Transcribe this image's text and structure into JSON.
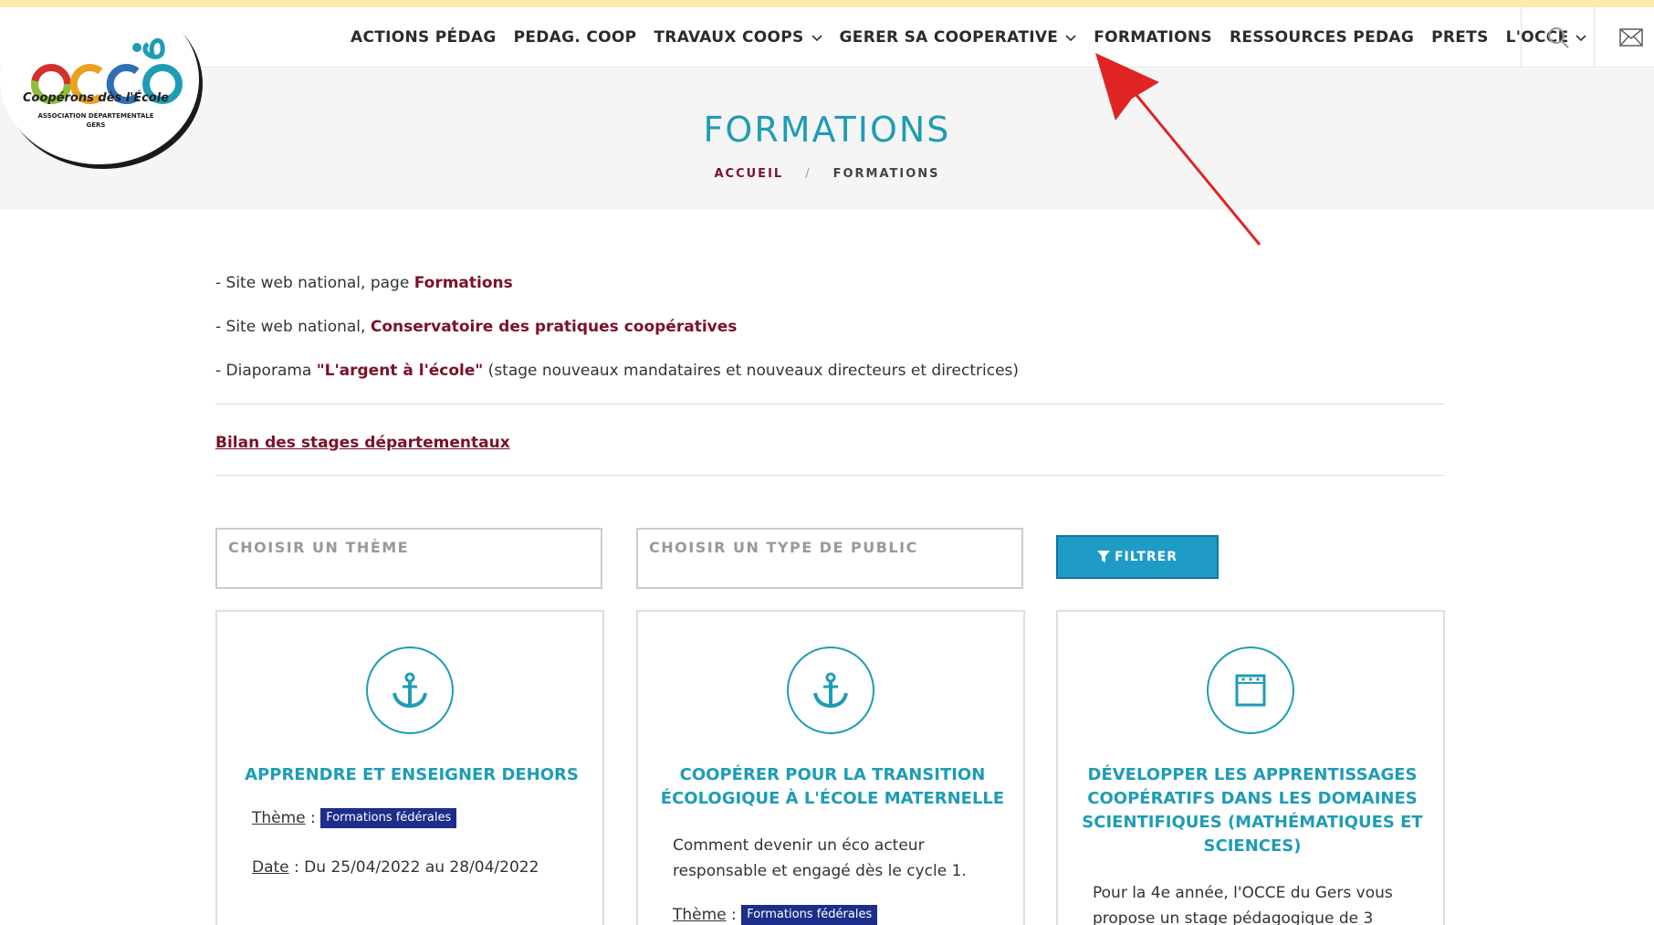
{
  "nav": {
    "items": [
      {
        "label": "ACTIONS PÉDAG",
        "dropdown": false
      },
      {
        "label": "PEDAG. COOP",
        "dropdown": false
      },
      {
        "label": "TRAVAUX COOPS",
        "dropdown": true
      },
      {
        "label": "GERER SA COOPERATIVE",
        "dropdown": true
      },
      {
        "label": "FORMATIONS",
        "dropdown": false
      },
      {
        "label": "RESSOURCES PEDAG",
        "dropdown": false
      },
      {
        "label": "PRETS",
        "dropdown": false
      },
      {
        "label": "L'OCCE",
        "dropdown": true
      }
    ],
    "icons": [
      "search-icon",
      "mail-icon"
    ]
  },
  "logo": {
    "wordmark": "occe",
    "tagline": "Coopérons dès l'École",
    "subline": "ASSOCIATION DÉPARTEMENTALE",
    "dept": "GERS"
  },
  "banner": {
    "title": "FORMATIONS",
    "breadcrumb_home": "ACCUEIL",
    "breadcrumb_sep": "/",
    "breadcrumb_current": "FORMATIONS"
  },
  "links": {
    "l1_prefix": "- Site web national, page ",
    "l1_link": "Formations",
    "l2_prefix": "- Site web national, ",
    "l2_link": "Conservatoire des pratiques coopératives",
    "l3_prefix": "- Diaporama ",
    "l3_link": "\"L'argent à l'école\"",
    "l3_suffix": " (stage nouveaux mandataires et nouveaux directeurs et directrices)",
    "bilan": "Bilan des stages départementaux"
  },
  "filters": {
    "theme_placeholder": "CHOISIR UN THÈME",
    "public_placeholder": "CHOISIR UN TYPE DE PUBLIC",
    "button": "FILTRER"
  },
  "cards": [
    {
      "icon": "anchor-icon",
      "title": "APPRENDRE ET ENSEIGNER DEHORS",
      "theme_label": "Thème",
      "theme_tag": "Formations fédérales",
      "date_label": "Date",
      "date_value": " : Du 25/04/2022 au 28/04/2022"
    },
    {
      "icon": "anchor-icon",
      "title": "COOPÉRER POUR LA TRANSITION ÉCOLOGIQUE À L'ÉCOLE MATERNELLE",
      "desc": "Comment devenir un éco acteur responsable et engagé dès le cycle 1.",
      "theme_label": "Thème",
      "theme_tag": "Formations fédérales"
    },
    {
      "icon": "notebook-icon",
      "title": "DÉVELOPPER LES APPRENTISSAGES COOPÉRATIFS DANS LES DOMAINES SCIENTIFIQUES (MATHÉMATIQUES ET SCIENCES)",
      "desc": "Pour la 4e année, l'OCCE du Gers vous propose un stage pédagogique de 3"
    }
  ],
  "colors": {
    "accent": "#1e9cb5",
    "link": "#7a1129",
    "button": "#1f9cc6",
    "tag": "#1c2e8a",
    "annotation_arrow": "#e02424"
  }
}
